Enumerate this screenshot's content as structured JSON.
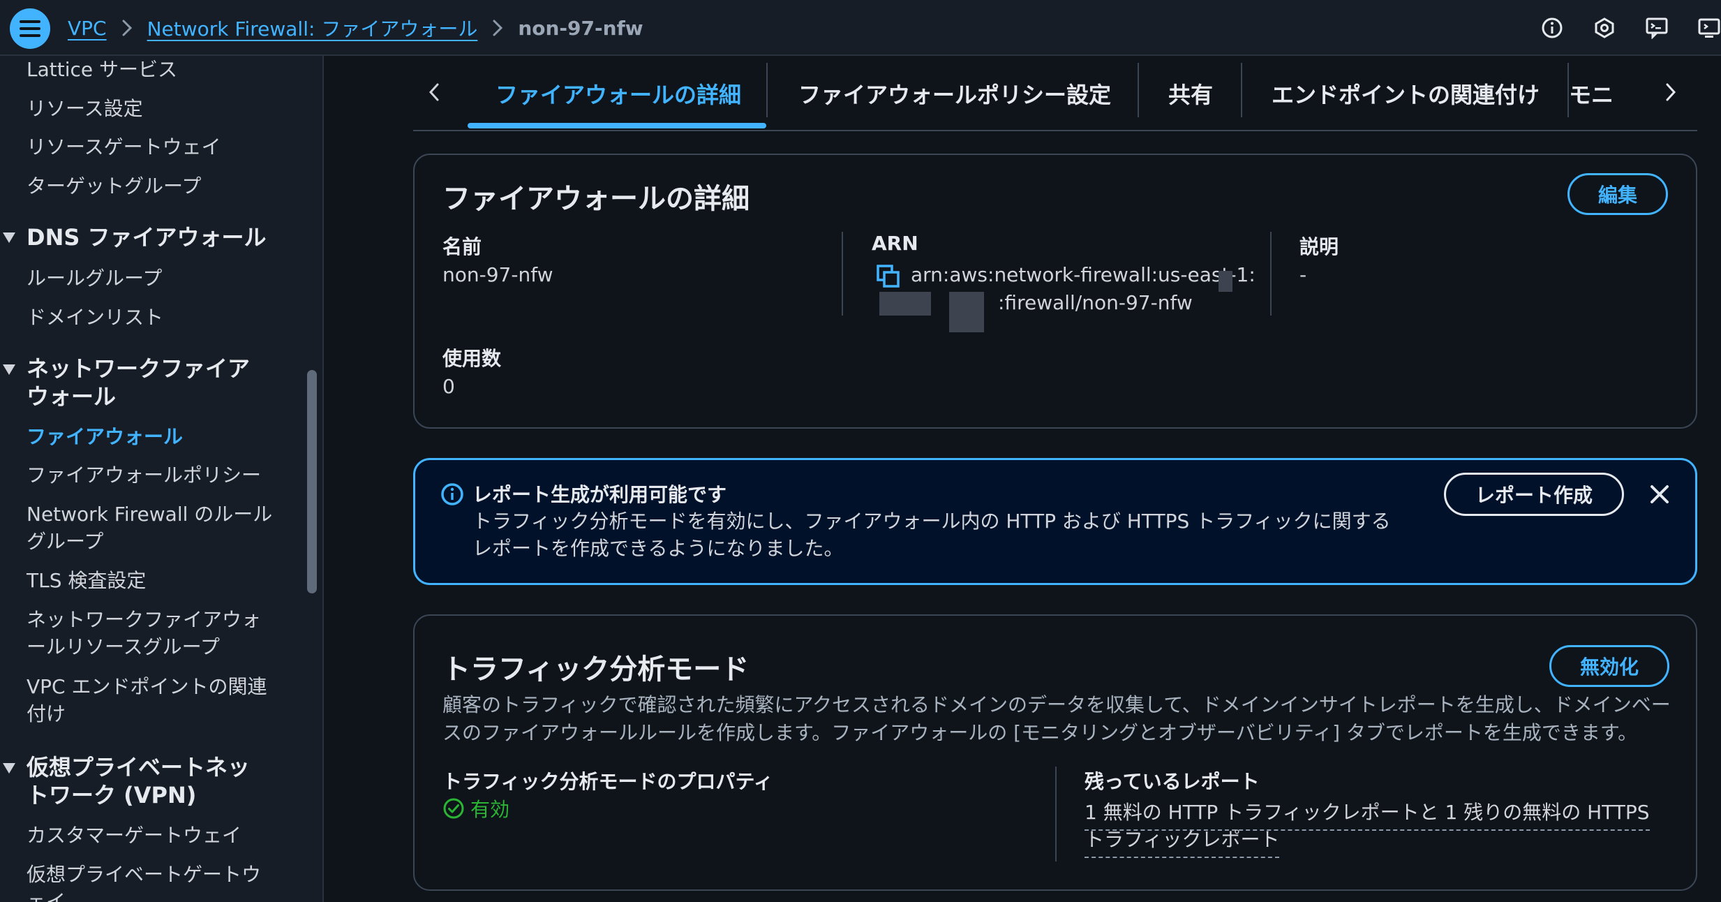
{
  "breadcrumb": {
    "vpc": "VPC",
    "network_firewall": "Network Firewall: ファイアウォール",
    "current": "non-97-nfw"
  },
  "sidebar": {
    "items_top": [
      "Lattice サービス",
      "リソース設定",
      "リソースゲートウェイ",
      "ターゲットグループ"
    ],
    "dns_section": "DNS ファイアウォール",
    "dns_items": [
      "ルールグループ",
      "ドメインリスト"
    ],
    "nfw_section_line1": "ネットワークファイア",
    "nfw_section_line2": "ウォール",
    "nfw_items": [
      "ファイアウォール",
      "ファイアウォールポリシー",
      "Network Firewall のルール",
      "グループ",
      "TLS 検査設定",
      "ネットワークファイアウォ",
      "ールリソースグループ",
      "VPC エンドポイントの関連",
      "付け"
    ],
    "vpn_section_line1": "仮想プライベートネッ",
    "vpn_section_line2": "トワーク (VPN)",
    "vpn_items": [
      "カスタマーゲートウェイ",
      "仮想プライベートゲートウ",
      "ェイ"
    ]
  },
  "tabs": [
    "ファイアウォールの詳細",
    "ファイアウォールポリシー設定",
    "共有",
    "エンドポイントの関連付け",
    "モニ"
  ],
  "details": {
    "title": "ファイアウォールの詳細",
    "edit_button": "編集",
    "name_label": "名前",
    "name_value": "non-97-nfw",
    "arn_label": "ARN",
    "arn_line1": "arn:aws:network-firewall:us-east-1:",
    "arn_line2": ":firewall/non-97-nfw",
    "desc_label": "説明",
    "desc_value": "-",
    "usage_label": "使用数",
    "usage_value": "0"
  },
  "alert": {
    "title": "レポート生成が利用可能です",
    "text": "トラフィック分析モードを有効にし、ファイアウォール内の HTTP および HTTPS トラフィックに関するレポートを作成できるようになりました。",
    "button": "レポート作成"
  },
  "traffic": {
    "title": "トラフィック分析モード",
    "disable_button": "無効化",
    "description": "顧客のトラフィックで確認された頻繁にアクセスされるドメインのデータを収集して、ドメインインサイトレポートを生成し、ドメインベースのファイアウォールルールを作成します。ファイアウォールの [モニタリングとオブザーバビリティ] タブでレポートを生成できます。",
    "prop_label": "トラフィック分析モードのプロパティ",
    "prop_status": "有効",
    "remaining_label": "残っているレポート",
    "remaining_value": "1 無料の HTTP トラフィックレポートと 1 残りの無料の HTTPS トラフィックレポート"
  },
  "colors": {
    "accent": "#42b4ff",
    "success": "#2bb534",
    "background": "#0f141a",
    "header": "#161d26"
  }
}
